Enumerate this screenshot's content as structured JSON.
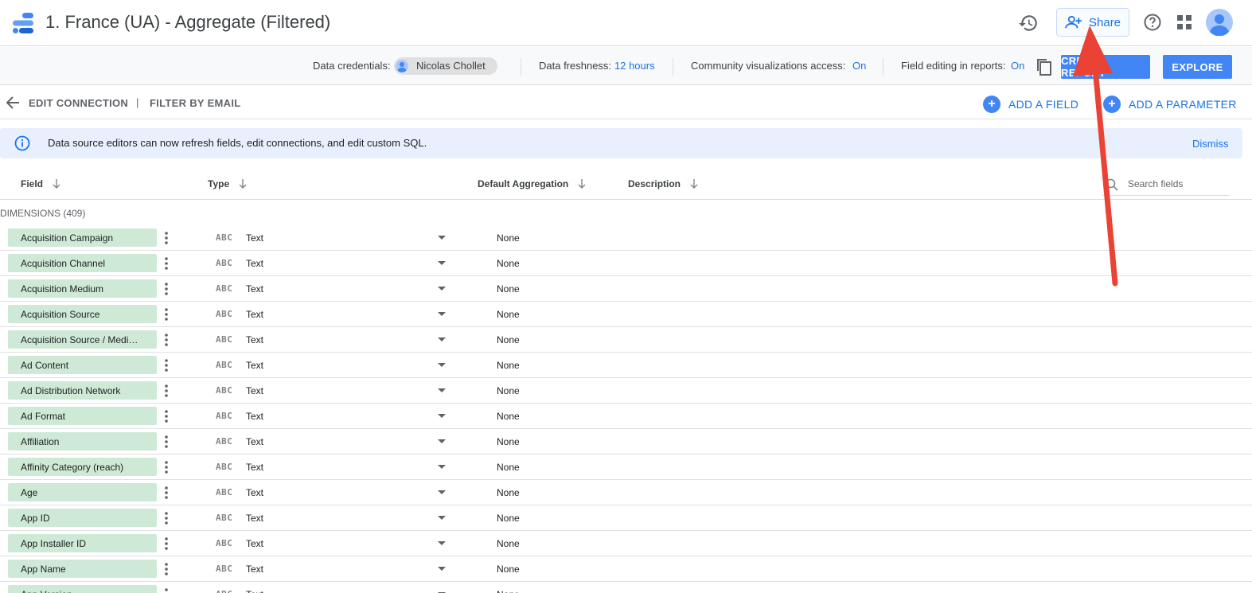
{
  "header": {
    "title": "1. France (UA) - Aggregate (Filtered)",
    "share_label": "Share",
    "icons": {
      "logo": "looker-studio-logo",
      "history": "history-icon",
      "help": "help-icon",
      "apps": "apps-grid-icon",
      "avatar": "account-avatar"
    }
  },
  "infobar": {
    "credentials_label": "Data credentials:",
    "credentials_user": "Nicolas Chollet",
    "freshness_label": "Data freshness:",
    "freshness_value": "12 hours",
    "community_label": "Community visualizations access:",
    "community_value": "On",
    "field_editing_label": "Field editing in reports:",
    "field_editing_value": "On",
    "create_report_label": "CREATE REPORT",
    "explore_label": "EXPLORE"
  },
  "connection": {
    "edit_connection_label": "EDIT CONNECTION",
    "separator": "|",
    "filter_label": "FILTER BY EMAIL",
    "add_field_label": "ADD A FIELD",
    "add_parameter_label": "ADD A PARAMETER"
  },
  "banner": {
    "message": "Data source editors can now refresh fields, edit connections, and edit custom SQL.",
    "dismiss_label": "Dismiss"
  },
  "table": {
    "columns": [
      "Field",
      "Type",
      "Default Aggregation",
      "Description"
    ],
    "search_placeholder": "Search fields",
    "dimensions_title": "DIMENSIONS (409)",
    "type_icon_text": "ABC",
    "rows": [
      {
        "field": "Acquisition Campaign",
        "type": "Text",
        "aggregation": "None"
      },
      {
        "field": "Acquisition Channel",
        "type": "Text",
        "aggregation": "None"
      },
      {
        "field": "Acquisition Medium",
        "type": "Text",
        "aggregation": "None"
      },
      {
        "field": "Acquisition Source",
        "type": "Text",
        "aggregation": "None"
      },
      {
        "field": "Acquisition Source / Medi…",
        "type": "Text",
        "aggregation": "None"
      },
      {
        "field": "Ad Content",
        "type": "Text",
        "aggregation": "None"
      },
      {
        "field": "Ad Distribution Network",
        "type": "Text",
        "aggregation": "None"
      },
      {
        "field": "Ad Format",
        "type": "Text",
        "aggregation": "None"
      },
      {
        "field": "Affiliation",
        "type": "Text",
        "aggregation": "None"
      },
      {
        "field": "Affinity Category (reach)",
        "type": "Text",
        "aggregation": "None"
      },
      {
        "field": "Age",
        "type": "Text",
        "aggregation": "None"
      },
      {
        "field": "App ID",
        "type": "Text",
        "aggregation": "None"
      },
      {
        "field": "App Installer ID",
        "type": "Text",
        "aggregation": "None"
      },
      {
        "field": "App Name",
        "type": "Text",
        "aggregation": "None"
      },
      {
        "field": "App Version",
        "type": "Text",
        "aggregation": "None"
      }
    ]
  },
  "colors": {
    "accent": "#1a73e8",
    "button_blue": "#4285f4",
    "dimension_chip": "#ceead6",
    "banner_bg": "#e8f0fe",
    "annotation_arrow": "#ea4335"
  }
}
